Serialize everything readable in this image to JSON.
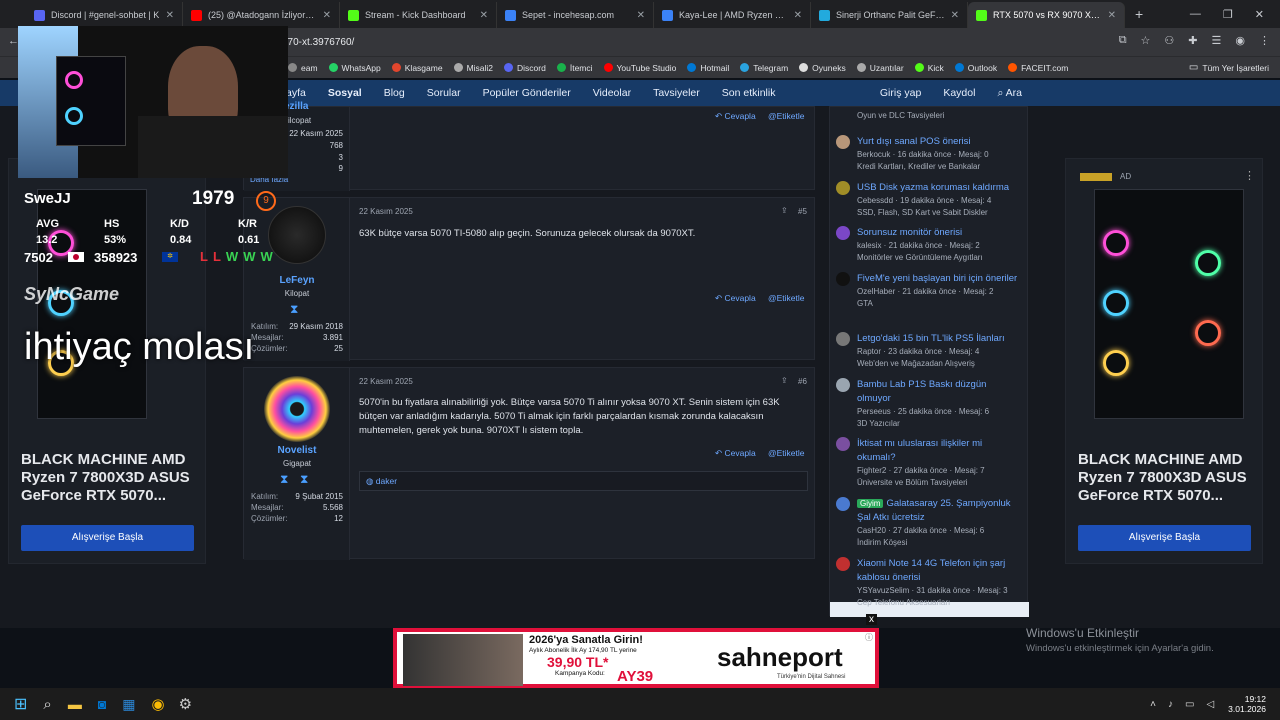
{
  "browser": {
    "tabs": [
      {
        "label": "Discord | #genel-sohbet | K",
        "color": "#5865f2"
      },
      {
        "label": "(25) @Atadogann İzliyor Kick &",
        "color": "#ff0000"
      },
      {
        "label": "Stream - Kick Dashboard",
        "color": "#53fc18"
      },
      {
        "label": "Sepet - incehesap.com",
        "color": "#3b82f6"
      },
      {
        "label": "Kaya-Lee | AMD Ryzen 5 7500",
        "color": "#3b82f6"
      },
      {
        "label": "Sinerji Orthanc Palit GeForce R",
        "color": "#22aadd"
      },
      {
        "label": "RTX 5070 vs RX 9070 XT | Tech",
        "color": "#53fc18"
      }
    ],
    "new_tab": "+",
    "url": "070-xt.3976760/",
    "bookmarks": [
      {
        "label": "eam",
        "color": "#888"
      },
      {
        "label": "WhatsApp",
        "color": "#25d366"
      },
      {
        "label": "Klasgame",
        "color": "#e2462d"
      },
      {
        "label": "Misali2",
        "color": "#aaaaaa"
      },
      {
        "label": "Discord",
        "color": "#5865f2"
      },
      {
        "label": "İtemci",
        "color": "#19b24b"
      },
      {
        "label": "YouTube Studio",
        "color": "#ff0000"
      },
      {
        "label": "Hotmail",
        "color": "#0078d4"
      },
      {
        "label": "Telegram",
        "color": "#2aa3df"
      },
      {
        "label": "Oyuneks",
        "color": "#dddddd"
      },
      {
        "label": "Uzantılar",
        "color": "#aaaaaa"
      },
      {
        "label": "Kick",
        "color": "#53fc18"
      },
      {
        "label": "Outlook",
        "color": "#0078d4"
      },
      {
        "label": "FACEIT.com",
        "color": "#ff5500"
      }
    ],
    "all_bookmarks": "Tüm Yer İşaretleri"
  },
  "nav": {
    "items": [
      "ayfa",
      "Sosyal",
      "Blog",
      "Sorular",
      "Popüler Gönderiler",
      "Videolar",
      "Tavsiyeler",
      "Son etkinlik"
    ],
    "login": "Giriş yap",
    "register": "Kaydol",
    "search": "Ara"
  },
  "ad": {
    "title": "BLACK MACHINE AMD Ryzen 7 7800X3D ASUS GeForce RTX 5070...",
    "button": "Alışverişe Başla",
    "badge": "AD"
  },
  "posts": [
    {
      "user": "ezilla",
      "title": "ilcopat",
      "stats": [
        {
          "k": "",
          "v": "22 Kasım 2025"
        },
        {
          "k": "",
          "v": "768"
        },
        {
          "k": "",
          "v": "3"
        },
        {
          "k": "",
          "v": "9"
        }
      ],
      "more": "Daha fazla",
      "reply": "Cevapla",
      "tag": "Etiketle"
    },
    {
      "date": "22 Kasım 2025",
      "num": "#5",
      "text": "63K bütçe varsa 5070 TI-5080 alıp geçin. Sorunuza gelecek olursak da 9070XT.",
      "user": "LeFeyn",
      "title": "Kilopat",
      "stats": [
        {
          "k": "Katılım:",
          "v": "29 Kasım 2018"
        },
        {
          "k": "Mesajlar:",
          "v": "3.891"
        },
        {
          "k": "Çözümler:",
          "v": "25"
        }
      ],
      "reply": "Cevapla",
      "tag": "Etiketle"
    },
    {
      "date": "22 Kasım 2025",
      "num": "#6",
      "text": "5070'in bu fiyatlara alınabilirliği yok. Bütçe varsa 5070 Ti alınır yoksa 9070 XT. Senin sistem için 63K bütçen var anladığım kadarıyla. 5070 Ti almak için farklı parçalardan kısmak zorunda kalacaksın muhtemelen, gerek yok buna. 9070XT lı sistem topla.",
      "user": "Novelist",
      "title": "Gigapat",
      "stats": [
        {
          "k": "Katılım:",
          "v": "9 Şubat 2015"
        },
        {
          "k": "Mesajlar:",
          "v": "5.568"
        },
        {
          "k": "Çözümler:",
          "v": "12"
        }
      ],
      "reply": "Cevapla",
      "tag": "Etiketle",
      "reaction": "daker"
    }
  ],
  "sidebar": {
    "top_meta": "Oyun ve DLC Tavsiyeleri",
    "items": [
      {
        "title": "Yurt dışı sanal POS önerisi",
        "meta": "Berkocuk · 16 dakika önce · Mesaj: 0",
        "cat": "Kredi Kartları, Krediler ve Bankalar",
        "color": "#b8977a"
      },
      {
        "title": "USB Disk yazma koruması kaldırma",
        "meta": "Cebessdd · 19 dakika önce · Mesaj: 4",
        "cat": "SSD, Flash, SD Kart ve Sabit Diskler",
        "color": "#a08d27"
      },
      {
        "title": "Sorunsuz monitör önerisi",
        "meta": "kalesix · 21 dakika önce · Mesaj: 2",
        "cat": "Monitörler ve Görüntüleme Aygıtları",
        "color": "#7b47c7"
      },
      {
        "title": "FiveM'e yeni başlayan biri için öneriler",
        "meta": "OzelHaber · 21 dakika önce · Mesaj: 2",
        "cat": "GTA",
        "color": "#111111"
      },
      {
        "title": "Letgo'daki 15 bin TL'lik PS5 İlanları",
        "meta": "Raptor · 23 dakika önce · Mesaj: 4",
        "cat": "Web'den ve Mağazadan Alışveriş",
        "color": "#777777"
      },
      {
        "title": "Bambu Lab P1S Baskı düzgün olmuyor",
        "meta": "Perseeus · 25 dakika önce · Mesaj: 6",
        "cat": "3D Yazıcılar",
        "color": "#9aa5b0"
      },
      {
        "title": "İktisat mı uluslarası ilişkiler mi okumalı?",
        "meta": "Fighter2 · 27 dakika önce · Mesaj: 7",
        "cat": "Üniversite ve Bölüm Tavsiyeleri",
        "color": "#7a4fa0"
      },
      {
        "title": "Galatasaray 25. Şampiyonluk Şal Atkı ücretsiz",
        "meta": "CasH20 · 27 dakika önce · Mesaj: 6",
        "cat": "İndirim Köşesi",
        "badge": "Giyim",
        "color": "#4a7ad0"
      },
      {
        "title": "Xiaomi Note 14 4G Telefon için şarj kablosu önerisi",
        "meta": "YSYavuzSelim · 31 dakika önce · Mesaj: 3",
        "cat": "Cep Telefonu Aksesuarları",
        "color": "#c03030"
      }
    ]
  },
  "overlay": {
    "name": "SweJJ",
    "elo": "1979",
    "level": "9",
    "headers": [
      "AVG",
      "HS",
      "K/D",
      "K/R"
    ],
    "values": [
      "13.2",
      "53%",
      "0.84",
      "0.61"
    ],
    "rank1": "7502",
    "rank2": "358923",
    "results": [
      "L",
      "L",
      "W",
      "W",
      "W"
    ],
    "break_text": "ihtiyaç molası",
    "brand": "SyNcGame"
  },
  "banner": {
    "headline": "2026'ya Sanatla Girin!",
    "sub": "Aylık Abonelik İlk Ay 174,90 TL yerine",
    "price": "39,90 TL*",
    "code_label": "Kampanya Kodu:",
    "code": "AY39",
    "brand": "sahneport",
    "tagline": "Türkiye'nin Dijital Sahnesi",
    "close": "x"
  },
  "windows": {
    "activate_title": "Windows'u Etkinleştir",
    "activate_sub": "Windows'u etkinleştirmek için Ayarlar'a gidin.",
    "time": "19:12",
    "date": "3.01.2026"
  }
}
